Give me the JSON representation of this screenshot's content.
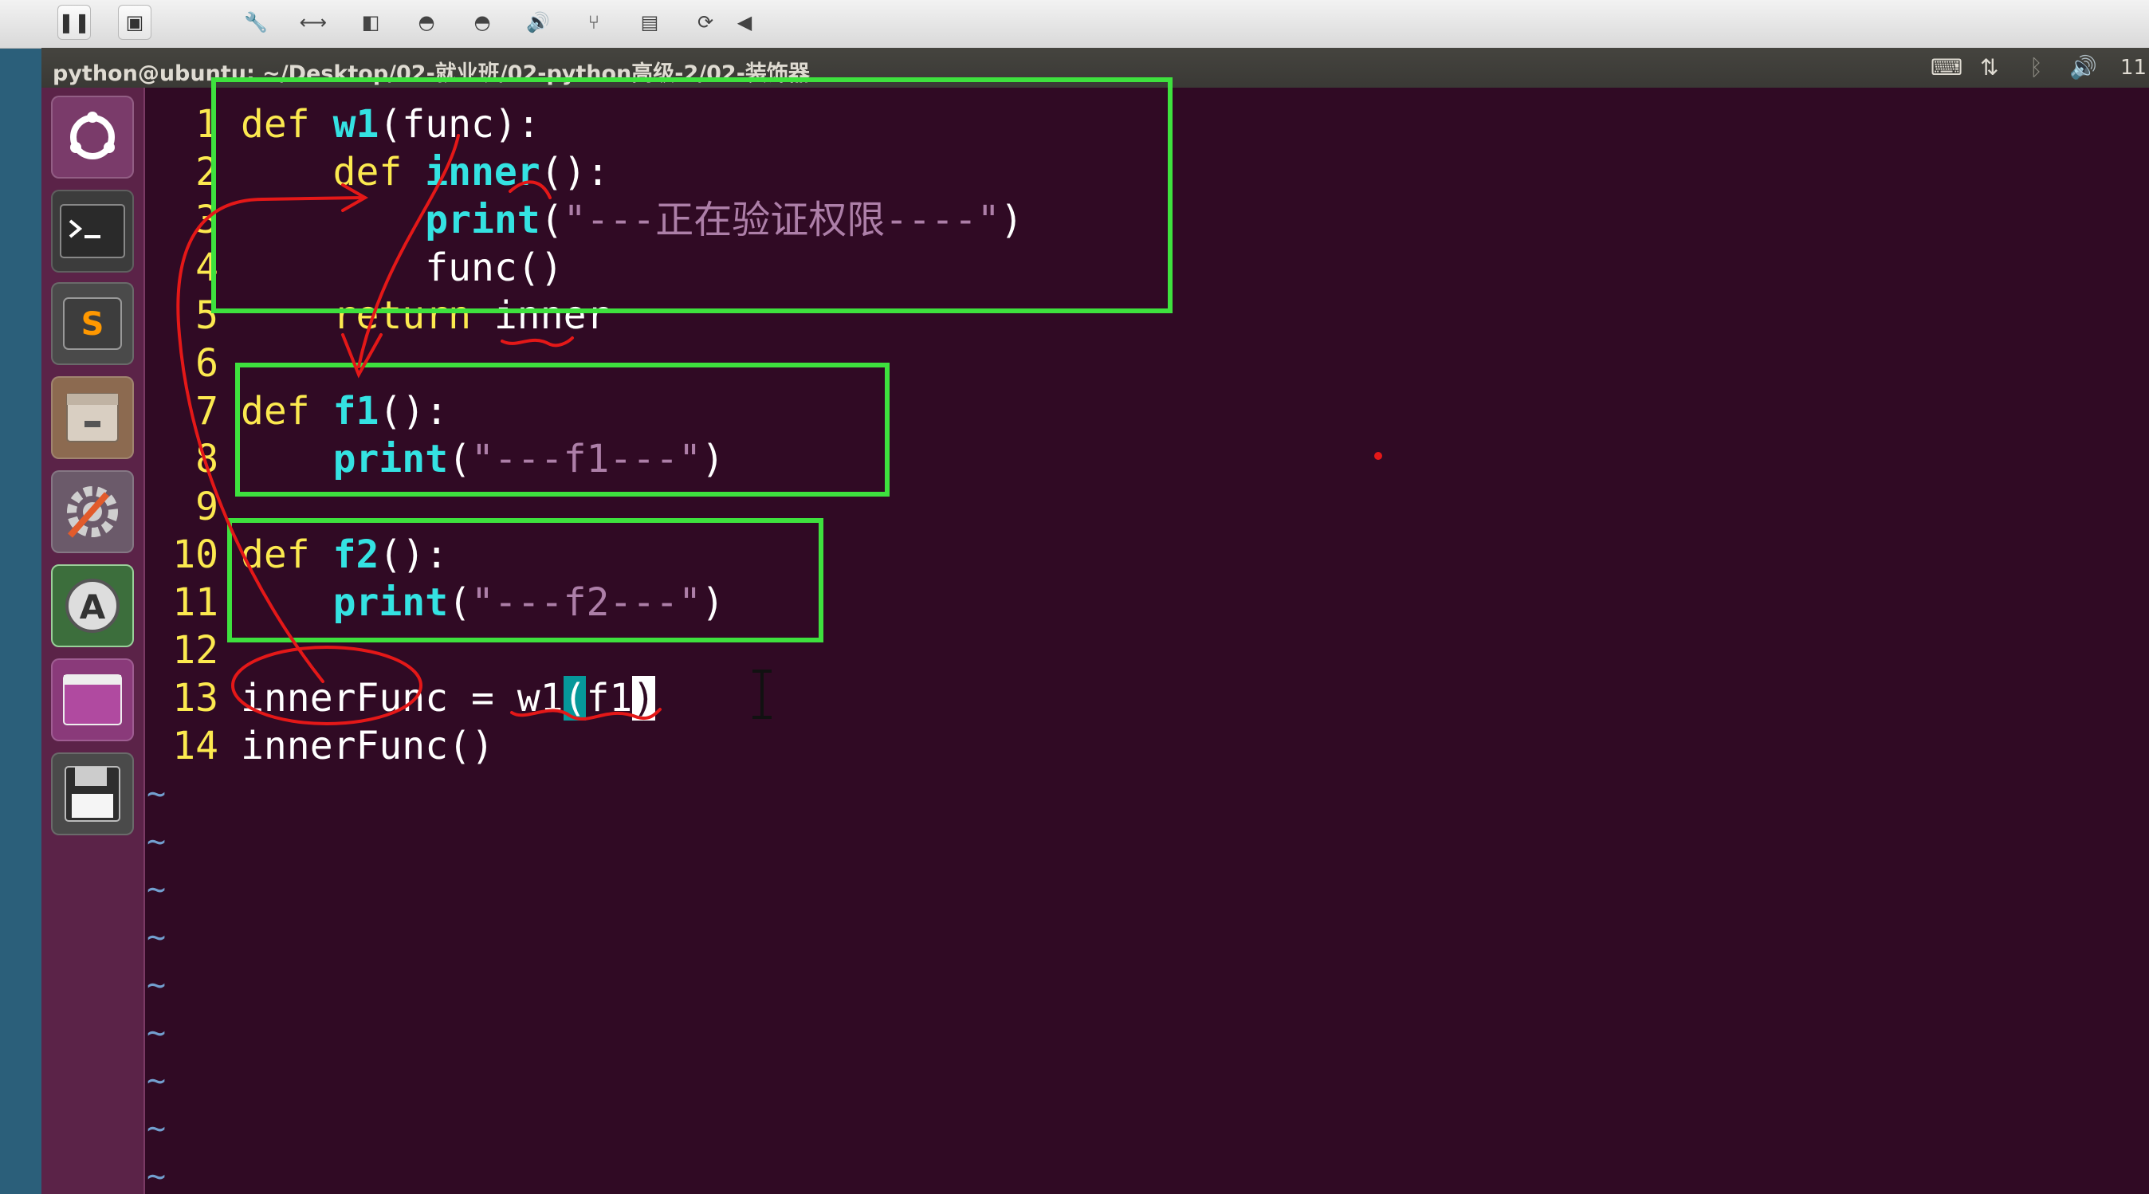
{
  "window_title": "python@ubuntu: ~/Desktop/02-就业班/02-python高级-2/02-装饰器",
  "clock": "11:",
  "code_lines": [
    {
      "n": "1",
      "parts": [
        {
          "t": "def ",
          "c": "kw"
        },
        {
          "t": "w1",
          "c": "fn"
        },
        {
          "t": "(func):",
          "c": "pl"
        }
      ]
    },
    {
      "n": "2",
      "parts": [
        {
          "t": "    def ",
          "c": "kw"
        },
        {
          "t": "inner",
          "c": "fn"
        },
        {
          "t": "():",
          "c": "pl"
        }
      ]
    },
    {
      "n": "3",
      "parts": [
        {
          "t": "        ",
          "c": "pl"
        },
        {
          "t": "print",
          "c": "fn"
        },
        {
          "t": "(",
          "c": "pl"
        },
        {
          "t": "\"---正在验证权限----\"",
          "c": "st"
        },
        {
          "t": ")",
          "c": "pl"
        }
      ]
    },
    {
      "n": "4",
      "parts": [
        {
          "t": "        func()",
          "c": "pl"
        }
      ]
    },
    {
      "n": "5",
      "parts": [
        {
          "t": "    return ",
          "c": "kw"
        },
        {
          "t": "inner",
          "c": "pl"
        }
      ]
    },
    {
      "n": "6",
      "parts": []
    },
    {
      "n": "7",
      "parts": [
        {
          "t": "def ",
          "c": "kw"
        },
        {
          "t": "f1",
          "c": "fn"
        },
        {
          "t": "():",
          "c": "pl"
        }
      ]
    },
    {
      "n": "8",
      "parts": [
        {
          "t": "    ",
          "c": "pl"
        },
        {
          "t": "print",
          "c": "fn"
        },
        {
          "t": "(",
          "c": "pl"
        },
        {
          "t": "\"---f1---\"",
          "c": "st"
        },
        {
          "t": ")",
          "c": "pl"
        }
      ]
    },
    {
      "n": "9",
      "parts": []
    },
    {
      "n": "10",
      "parts": [
        {
          "t": "def ",
          "c": "kw"
        },
        {
          "t": "f2",
          "c": "fn"
        },
        {
          "t": "():",
          "c": "pl"
        }
      ]
    },
    {
      "n": "11",
      "parts": [
        {
          "t": "    ",
          "c": "pl"
        },
        {
          "t": "print",
          "c": "fn"
        },
        {
          "t": "(",
          "c": "pl"
        },
        {
          "t": "\"---f2---\"",
          "c": "st"
        },
        {
          "t": ")",
          "c": "pl"
        }
      ]
    },
    {
      "n": "12",
      "parts": []
    },
    {
      "n": "13",
      "parts": [
        {
          "t": "innerFunc = w1",
          "c": "pl"
        },
        {
          "t": "(",
          "c": "hl"
        },
        {
          "t": "f1",
          "c": "pl"
        },
        {
          "t": ")",
          "c": "cur"
        }
      ]
    },
    {
      "n": "14",
      "parts": [
        {
          "t": "innerFunc()",
          "c": "pl"
        }
      ]
    }
  ],
  "empty_marker": "~",
  "empty_line_count": 9,
  "launcher_items": [
    {
      "name": "dash-home-icon"
    },
    {
      "name": "terminal-icon"
    },
    {
      "name": "sublime-text-icon"
    },
    {
      "name": "file-manager-icon"
    },
    {
      "name": "system-settings-icon"
    },
    {
      "name": "software-updater-icon"
    },
    {
      "name": "workspace-switcher-icon"
    },
    {
      "name": "save-disk-icon"
    }
  ],
  "colors": {
    "editor_bg": "#300a24",
    "keyword": "#fce94f",
    "function": "#34e2e2",
    "string": "#ad7fa8",
    "annotation_box": "#3ee13e",
    "annotation_pen": "#e41818"
  }
}
